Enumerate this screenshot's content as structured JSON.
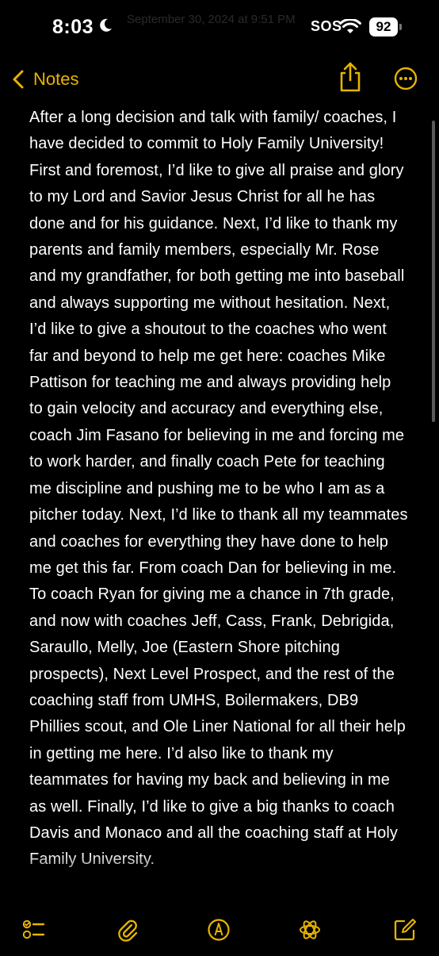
{
  "status_bar": {
    "time": "8:03",
    "ghost_title": "September 30, 2024 at 9:51 PM",
    "sos": "SOS",
    "battery": "92"
  },
  "nav": {
    "back_label": "Notes",
    "accent_color": "#E8B400"
  },
  "note": {
    "text": "After a long decision and talk with family/ coaches, I have decided to commit to Holy Family University! First and foremost, I’d like to give all praise and glory to my Lord and Savior Jesus Christ for all he has done and for his guidance. Next, I’d like to thank my parents and family members, especially Mr. Rose and my grandfather, for both getting me into baseball and always supporting me without hesitation. Next, I’d like to give a shoutout to the coaches who went far and beyond to help me get here: coaches Mike Pattison for teaching me and always providing help to gain velocity and accuracy and everything else, coach Jim Fasano for believing in me and forcing me to work harder, and finally coach Pete for teaching me discipline and pushing me to be who I am as a pitcher today. Next, I’d like to thank all my teammates and coaches for everything they have done to help me get this far. From coach Dan for believing in me. To coach Ryan for giving me a chance in 7th grade, and now with coaches Jeff, Cass, Frank, Debrigida, Saraullo, Melly, Joe (Eastern Shore pitching prospects), Next Level Prospect, and the rest of the coaching staff from UMHS, Boilermakers, DB9 Phillies scout, and Ole Liner National for all their help in getting me here. I’d also like to thank my teammates for having my back and believing in me as well. Finally, I’d like to give a big thanks to coach Davis and Monaco and all the coaching staff at Holy Family University."
  },
  "toolbar": {
    "icons": [
      "checklist-icon",
      "paperclip-icon",
      "markup-pen-icon",
      "apple-intelligence-icon",
      "compose-icon"
    ]
  }
}
